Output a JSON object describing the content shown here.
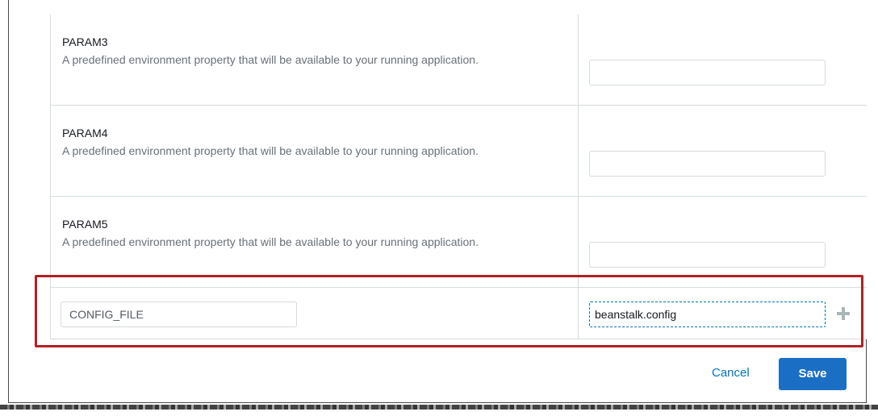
{
  "params": [
    {
      "name": "PARAM3",
      "description": "A predefined environment property that will be available to your running application.",
      "value": ""
    },
    {
      "name": "PARAM4",
      "description": "A predefined environment property that will be available to your running application.",
      "value": ""
    },
    {
      "name": "PARAM5",
      "description": "A predefined environment property that will be available to your running application.",
      "value": ""
    }
  ],
  "custom_property": {
    "name": "CONFIG_FILE",
    "value": "beanstalk.config",
    "add_icon": "plus-icon"
  },
  "footer": {
    "cancel_label": "Cancel",
    "save_label": "Save"
  },
  "colors": {
    "highlight": "#b32025",
    "primary_button": "#1a6fc4",
    "link": "#0073bb"
  }
}
